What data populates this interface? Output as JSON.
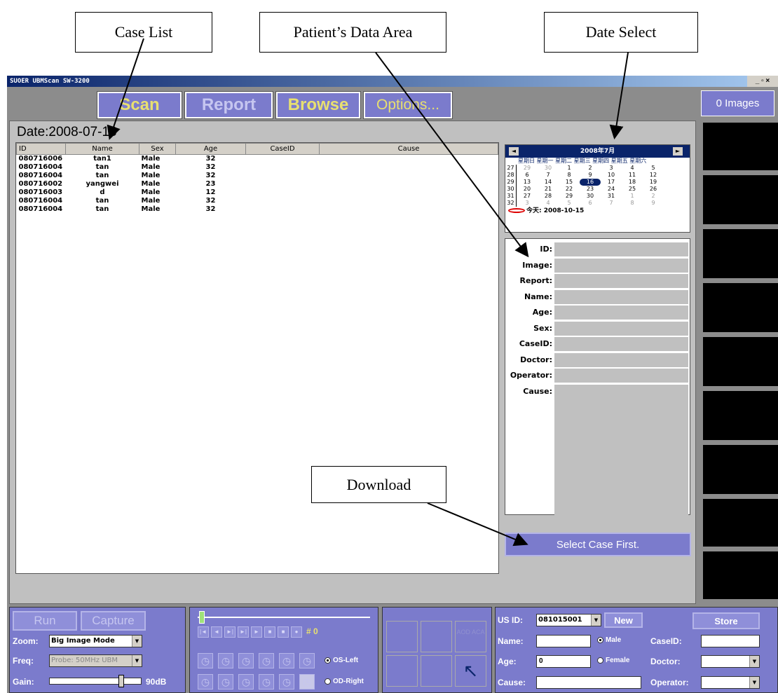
{
  "annotations": {
    "case_list": "Case List",
    "patient_data_area": "Patient’s Data Area",
    "date_select": "Date Select",
    "download": "Download"
  },
  "window": {
    "title": "SUOER UBMScan SW-3200",
    "buttons": "_ ▫ ×"
  },
  "mode_tabs": [
    "Scan",
    "Report",
    "Browse",
    "Options..."
  ],
  "images_count": "0 Images",
  "date_label": "Date:2008-07-16",
  "case_table": {
    "columns": [
      "ID",
      "Name",
      "Sex",
      "Age",
      "CaseID",
      "Cause"
    ],
    "rows": [
      [
        "080716006",
        "tan1",
        "Male",
        "32"
      ],
      [
        "080716004",
        "tan",
        "Male",
        "32"
      ],
      [
        "080716004",
        "tan",
        "Male",
        "32"
      ],
      [
        "080716002",
        "yangwei",
        "Male",
        "23"
      ],
      [
        "080716003",
        "d",
        "Male",
        "12"
      ],
      [
        "080716004",
        "tan",
        "Male",
        "32"
      ],
      [
        "080716004",
        "tan",
        "Male",
        "32"
      ]
    ]
  },
  "calendar": {
    "month_title": "2008年7月",
    "prev": "◄",
    "next": "►",
    "weekdays": "星期日 星期一 星期二 星期三 星期四 星期五 星期六",
    "weeks": [
      [
        "27",
        "29",
        "30",
        "1",
        "2",
        "3",
        "4",
        "5"
      ],
      [
        "28",
        "6",
        "7",
        "8",
        "9",
        "10",
        "11",
        "12"
      ],
      [
        "29",
        "13",
        "14",
        "15",
        "16",
        "17",
        "18",
        "19"
      ],
      [
        "30",
        "20",
        "21",
        "22",
        "23",
        "24",
        "25",
        "26"
      ],
      [
        "31",
        "27",
        "28",
        "29",
        "30",
        "31",
        "1",
        "2"
      ],
      [
        "32",
        "3",
        "4",
        "5",
        "6",
        "7",
        "8",
        "9"
      ]
    ],
    "selected_day": "16",
    "today_label": "今天: 2008-10-15"
  },
  "patient_fields": [
    "ID:",
    "Image:",
    "Report:",
    "Name:",
    "Age:",
    "Sex:",
    "CaseID:",
    "Doctor:",
    "Operator:",
    "Cause:"
  ],
  "download_button": "Select Case First.",
  "bottom": {
    "run": "Run",
    "capture": "Capture",
    "zoom_label": "Zoom:",
    "zoom_value": "Big Image Mode",
    "freq_label": "Freq:",
    "freq_value": "Probe: 50MHz UBM",
    "gain_label": "Gain:",
    "gain_value": "90dB",
    "frame_counter": "# 0",
    "os_left": "OS-Left",
    "od_right": "OD-Right",
    "aod_label": "AOD\nACA",
    "us_id_label": "US ID:",
    "us_id_value": "081015001",
    "new_button": "New",
    "store_button": "Store",
    "name_label": "Name:",
    "male": "Male",
    "female": "Female",
    "caseid_label": "CaseID:",
    "age_label": "Age:",
    "age_value": "0",
    "doctor_label": "Doctor:",
    "cause_label": "Cause:",
    "operator_label": "Operator:"
  }
}
